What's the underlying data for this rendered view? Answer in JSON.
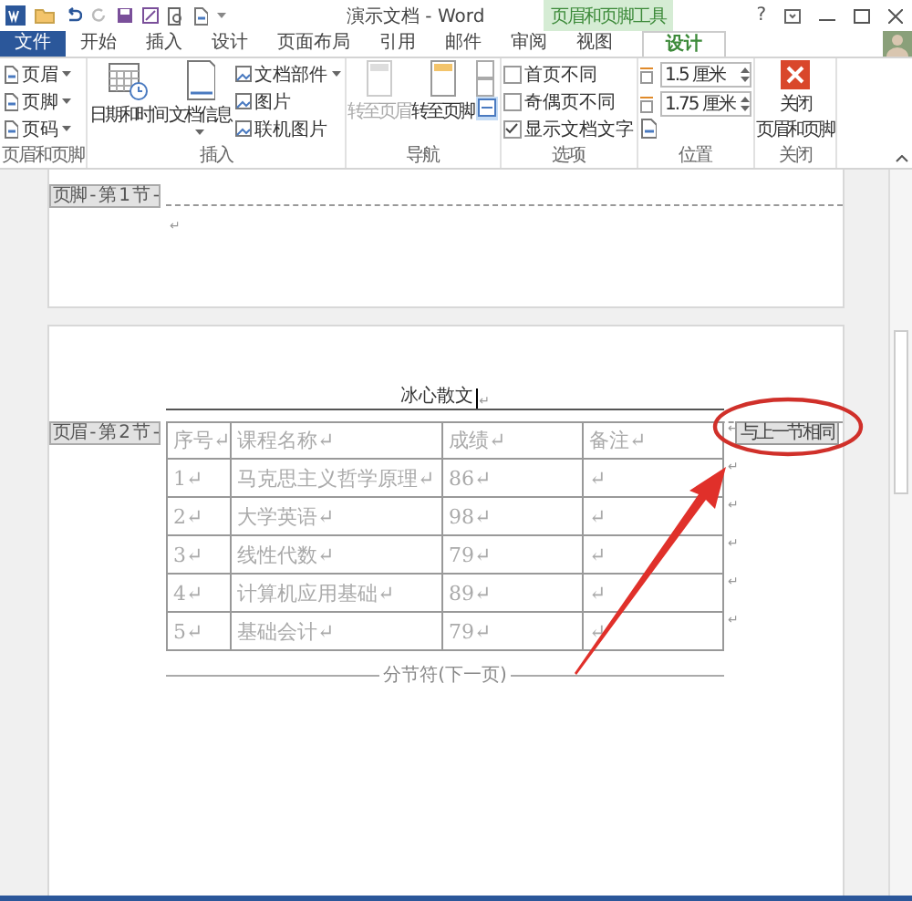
{
  "window": {
    "title": "演示文档 - Word",
    "context_tab": "页眉和页脚工具",
    "help": "?"
  },
  "tabs": [
    {
      "label": "文件",
      "kind": "file",
      "selected": false
    },
    {
      "label": "开始",
      "kind": "normal",
      "selected": false
    },
    {
      "label": "插入",
      "kind": "normal",
      "selected": false
    },
    {
      "label": "设计",
      "kind": "normal",
      "selected": false
    },
    {
      "label": "页面布局",
      "kind": "normal",
      "selected": false
    },
    {
      "label": "引用",
      "kind": "normal",
      "selected": false
    },
    {
      "label": "邮件",
      "kind": "normal",
      "selected": false
    },
    {
      "label": "审阅",
      "kind": "normal",
      "selected": false
    },
    {
      "label": "视图",
      "kind": "normal",
      "selected": false
    },
    {
      "label": "设计",
      "kind": "context",
      "selected": true
    }
  ],
  "ribbon": {
    "header_footer": {
      "label": "页眉和页脚",
      "items": [
        "页眉",
        "页脚",
        "页码"
      ]
    },
    "insert": {
      "label": "插入",
      "date_time": "日期和时间",
      "doc_info": "文档信息",
      "small_items": [
        {
          "label": "文档部件",
          "dropdown": true
        },
        {
          "label": "图片",
          "dropdown": false
        },
        {
          "label": "联机图片",
          "dropdown": false
        }
      ]
    },
    "navigation": {
      "label": "导航",
      "goto_header": {
        "label": "转至页眉",
        "disabled": true
      },
      "goto_footer": {
        "label": "转至页脚",
        "disabled": false
      },
      "link_previous": {
        "on": true
      }
    },
    "options": {
      "label": "选项",
      "items": [
        {
          "label": "首页不同",
          "checked": false
        },
        {
          "label": "奇偶页不同",
          "checked": false
        },
        {
          "label": "显示文档文字",
          "checked": true
        }
      ]
    },
    "position": {
      "label": "位置",
      "header_distance": "1.5 厘米",
      "footer_distance": "1.75 厘米"
    },
    "close": {
      "label": "关闭",
      "button": [
        "关闭",
        "页眉和页脚"
      ]
    }
  },
  "document": {
    "footer_label": "页脚 - 第 1 节 -",
    "footer_mark": "↵",
    "header_label": "页眉 - 第 2 节 -",
    "header_text": "冰心散文",
    "header_mark": "↵",
    "same_as_previous": "与上一节相同",
    "table": {
      "columns": [
        "序号↵",
        "课程名称↵",
        "成绩↵",
        "备注↵"
      ],
      "header_end": "↵",
      "rows": [
        {
          "cells": [
            "1↵",
            "马克思主义哲学原理↵",
            "86↵",
            "↵"
          ],
          "end": "↵"
        },
        {
          "cells": [
            "2↵",
            "大学英语↵",
            "98↵",
            "↵"
          ],
          "end": "↵"
        },
        {
          "cells": [
            "3↵",
            "线性代数↵",
            "79↵",
            "↵"
          ],
          "end": "↵"
        },
        {
          "cells": [
            "4↵",
            "计算机应用基础↵",
            "89↵",
            "↵"
          ],
          "end": "↵"
        },
        {
          "cells": [
            "5↵",
            "基础会计↵",
            "79↵",
            "↵"
          ],
          "end": "↵"
        }
      ]
    },
    "section_break": "分节符(下一页)"
  }
}
